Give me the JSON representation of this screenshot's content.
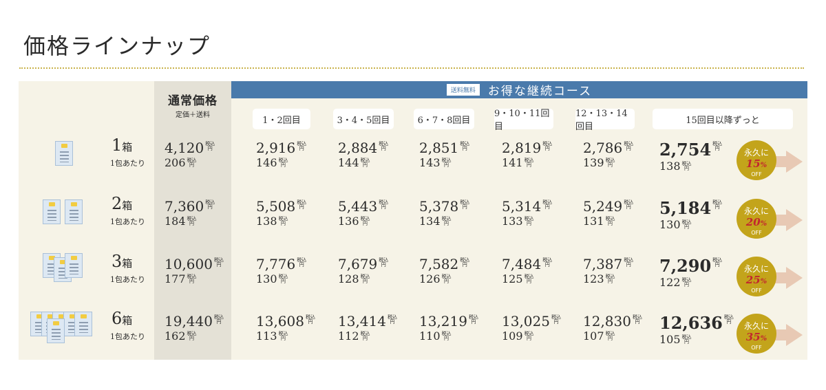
{
  "page": {
    "title": "価格ラインナップ"
  },
  "header": {
    "regular_title": "通常価格",
    "regular_sub": "定価＋送料",
    "free_shipping": "送料無料",
    "course_title": "お得な継続コース",
    "columns": [
      "1・2回目",
      "3・4・5回目",
      "6・7・8回目",
      "9・10・11回目",
      "12・13・14回目",
      "15回目以降ずっと"
    ]
  },
  "tax_label": "税込\n円",
  "rows": [
    {
      "qty": "1",
      "unit": "箱",
      "per": "1包あたり",
      "regular": {
        "main": "4,120",
        "sub": "206"
      },
      "prices": [
        {
          "main": "2,916",
          "sub": "146"
        },
        {
          "main": "2,884",
          "sub": "144"
        },
        {
          "main": "2,851",
          "sub": "143"
        },
        {
          "main": "2,819",
          "sub": "141"
        },
        {
          "main": "2,786",
          "sub": "139"
        },
        {
          "main": "2,754",
          "sub": "138"
        }
      ],
      "badge": {
        "line1": "永久に",
        "pct": "15",
        "pct_unit": "%",
        "off": "OFF"
      }
    },
    {
      "qty": "2",
      "unit": "箱",
      "per": "1包あたり",
      "regular": {
        "main": "7,360",
        "sub": "184"
      },
      "prices": [
        {
          "main": "5,508",
          "sub": "138"
        },
        {
          "main": "5,443",
          "sub": "136"
        },
        {
          "main": "5,378",
          "sub": "134"
        },
        {
          "main": "5,314",
          "sub": "133"
        },
        {
          "main": "5,249",
          "sub": "131"
        },
        {
          "main": "5,184",
          "sub": "130"
        }
      ],
      "badge": {
        "line1": "永久に",
        "pct": "20",
        "pct_unit": "%",
        "off": "OFF"
      }
    },
    {
      "qty": "3",
      "unit": "箱",
      "per": "1包あたり",
      "regular": {
        "main": "10,600",
        "sub": "177"
      },
      "prices": [
        {
          "main": "7,776",
          "sub": "130"
        },
        {
          "main": "7,679",
          "sub": "128"
        },
        {
          "main": "7,582",
          "sub": "126"
        },
        {
          "main": "7,484",
          "sub": "125"
        },
        {
          "main": "7,387",
          "sub": "123"
        },
        {
          "main": "7,290",
          "sub": "122"
        }
      ],
      "badge": {
        "line1": "永久に",
        "pct": "25",
        "pct_unit": "%",
        "off": "OFF"
      }
    },
    {
      "qty": "6",
      "unit": "箱",
      "per": "1包あたり",
      "regular": {
        "main": "19,440",
        "sub": "162"
      },
      "prices": [
        {
          "main": "13,608",
          "sub": "113"
        },
        {
          "main": "13,414",
          "sub": "112"
        },
        {
          "main": "13,219",
          "sub": "110"
        },
        {
          "main": "13,025",
          "sub": "109"
        },
        {
          "main": "12,830",
          "sub": "107"
        },
        {
          "main": "12,636",
          "sub": "105"
        }
      ],
      "badge": {
        "line1": "永久に",
        "pct": "35",
        "pct_unit": "%",
        "off": "OFF"
      }
    }
  ],
  "colors": {
    "accent_blue": "#4a7aab",
    "badge_gold": "#c3a41b",
    "discount_red": "#c2262e",
    "panel_bg": "#f6f3e7"
  }
}
